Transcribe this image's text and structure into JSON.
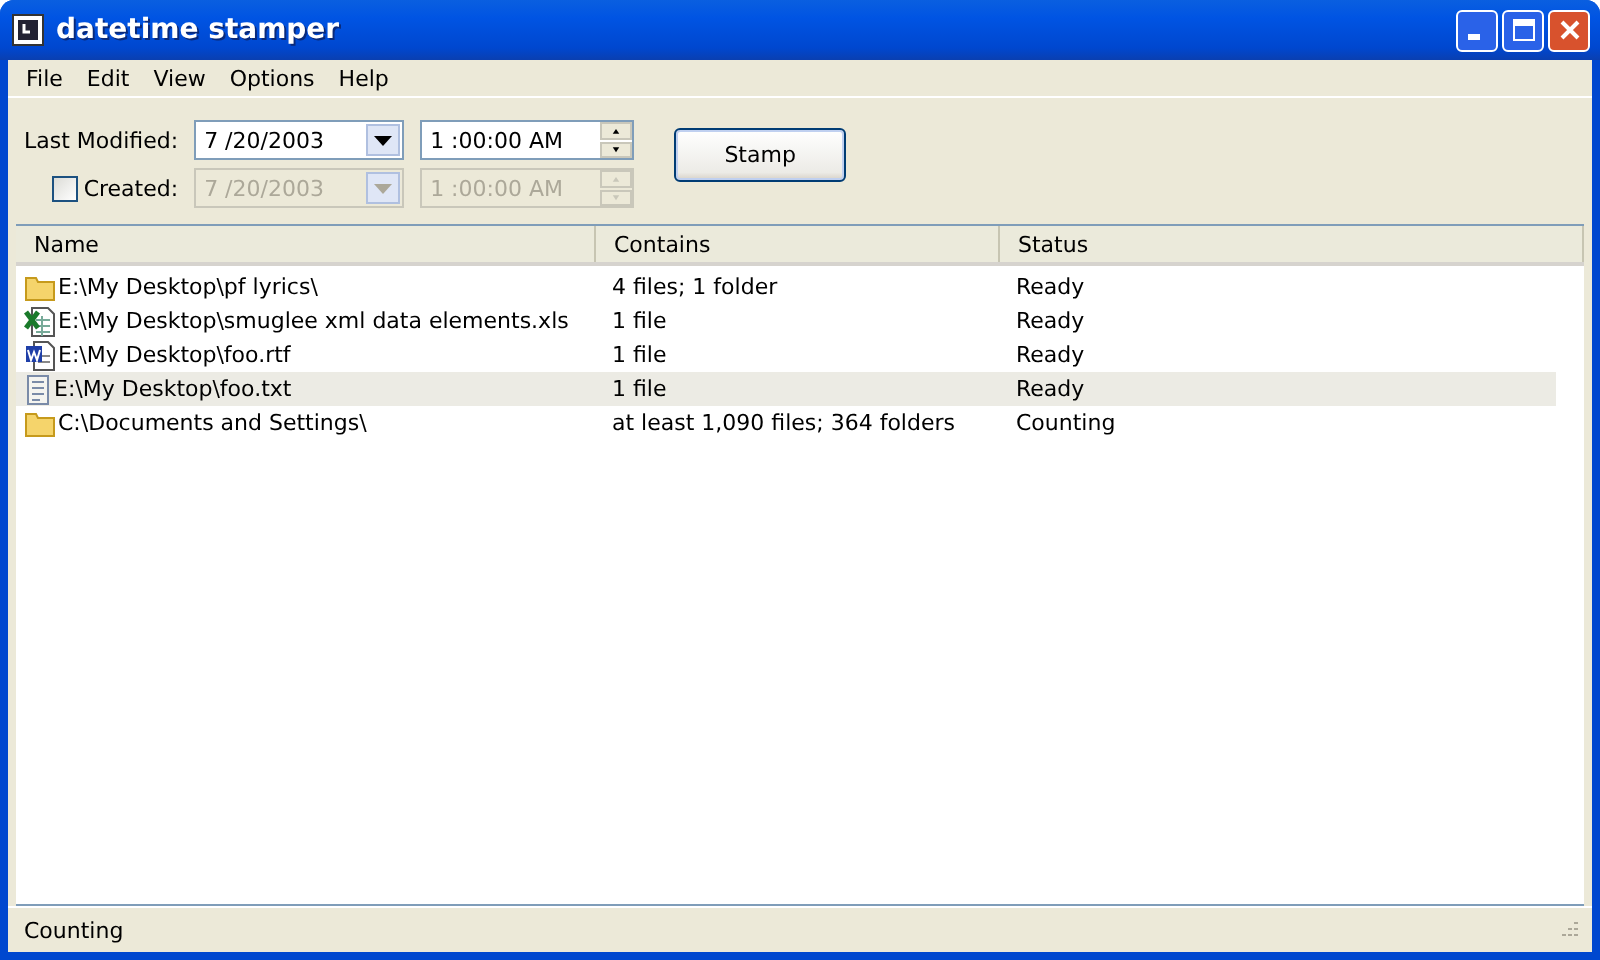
{
  "window": {
    "title": "datetime stamper"
  },
  "menu": [
    "File",
    "Edit",
    "View",
    "Options",
    "Help"
  ],
  "last_modified": {
    "label": "Last Modified:",
    "date": "7 /20/2003",
    "time": "1 :00:00 AM"
  },
  "created": {
    "label": "Created:",
    "checked": false,
    "disabled": true,
    "date": "7 /20/2003",
    "time": "1 :00:00 AM"
  },
  "stamp_button": "Stamp",
  "table": {
    "columns": [
      "Name",
      "Contains",
      "Status"
    ],
    "rows": [
      {
        "kind": "folder",
        "name": "E:\\My Desktop\\pf lyrics\\",
        "contains": "4 files; 1 folder",
        "status": "Ready",
        "selected": false
      },
      {
        "kind": "spreadsheet",
        "name": "E:\\My Desktop\\smuglee xml data elements.xls",
        "contains": "1 file",
        "status": "Ready",
        "selected": false
      },
      {
        "kind": "document",
        "name": "E:\\My Desktop\\foo.rtf",
        "contains": "1 file",
        "status": "Ready",
        "selected": false
      },
      {
        "kind": "text",
        "name": "E:\\My Desktop\\foo.txt",
        "contains": "1 file",
        "status": "Ready",
        "selected": true
      },
      {
        "kind": "folder",
        "name": "C:\\Documents and Settings\\",
        "contains": "at least 1,090 files; 364 folders",
        "status": "Counting",
        "selected": false
      }
    ]
  },
  "status_bar": "Counting"
}
